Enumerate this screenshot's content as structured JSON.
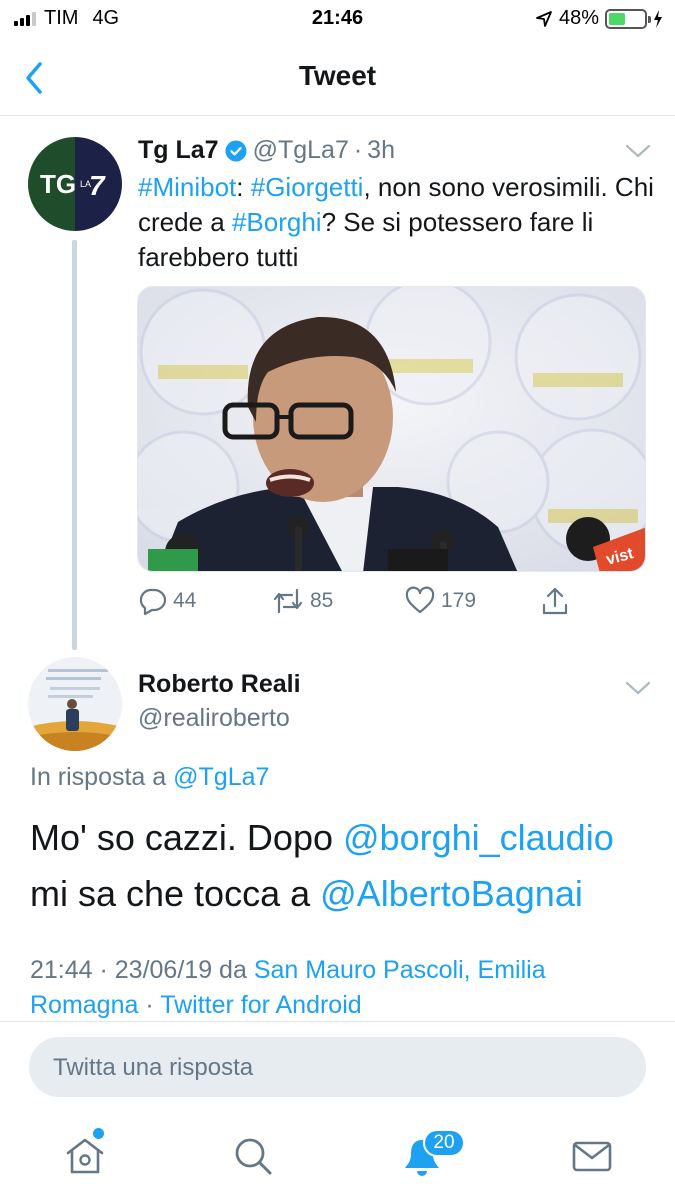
{
  "status_bar": {
    "carrier": "TIM",
    "network": "4G",
    "time": "21:46",
    "battery": "48%",
    "battery_level": 0.48
  },
  "header": {
    "title": "Tweet"
  },
  "tweet": {
    "name": "Tg La7",
    "handle": "@TgLa7",
    "separator": "·",
    "time": "3h",
    "avatar_text": "TG",
    "avatar_small": "LA",
    "avatar_seven": "7",
    "text_parts": {
      "tag1": "#Minibot",
      "colon": ": ",
      "tag2": "#Giorgetti",
      "mid1": ", non sono verosimili. Chi crede a ",
      "tag3": "#Borghi",
      "end": "? Se si potessero fare li farebbero tutti"
    },
    "actions": {
      "replies": "44",
      "retweets": "85",
      "likes": "179"
    }
  },
  "reply": {
    "name": "Roberto Reali",
    "handle": "@realiroberto",
    "in_reply_label": "In risposta a",
    "in_reply_handle": "@TgLa7",
    "text_parts": {
      "a": "Mo' so cazzi. Dopo ",
      "m1": "@borghi_claudio",
      "b": " mi sa che tocca a ",
      "m2": "@AlbertoBagnai"
    },
    "meta": {
      "datetime": "21:44 · 23/06/19 da",
      "location": "San Mauro Pascoli, Emilia Romagna",
      "sep": "·",
      "client": "Twitter for Android"
    }
  },
  "reply_box": {
    "placeholder": "Twitta una risposta"
  },
  "tabbar": {
    "notifications_count": "20"
  },
  "colors": {
    "accent": "#1da1f2",
    "muted": "#657786",
    "text": "#14171a",
    "tgla7_green": "#1f4d2b",
    "tgla7_navy": "#1c2147"
  },
  "icons": [
    "back-chevron-icon",
    "verified-icon",
    "chevron-down-icon",
    "reply-icon",
    "retweet-icon",
    "like-icon",
    "share-icon",
    "home-icon",
    "search-icon",
    "notifications-icon",
    "messages-icon"
  ]
}
